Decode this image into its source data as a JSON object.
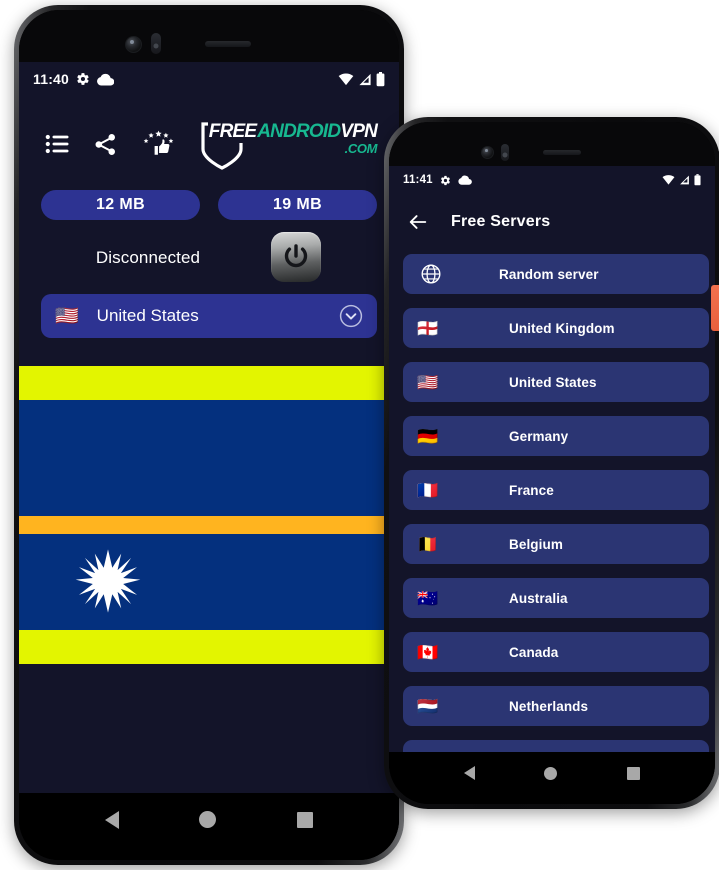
{
  "phone_home": {
    "statusbar": {
      "time": "11:40",
      "icons": [
        "gear-icon",
        "cloud-icon",
        "wifi-icon",
        "signal-icon",
        "battery-icon"
      ]
    },
    "header": {
      "icons": [
        {
          "name": "menu-list-icon",
          "label": "Menu"
        },
        {
          "name": "share-icon",
          "label": "Share"
        },
        {
          "name": "rate-thumbs-up-icon",
          "label": "Rate us"
        }
      ],
      "brand": {
        "part_free": "FREE",
        "part_android": "ANDROID",
        "part_vpn": "VPN",
        "part_com": ".COM",
        "color_white": "#ffffff",
        "color_teal": "#17b890"
      }
    },
    "stats": {
      "download": "12 MB",
      "upload": "19 MB"
    },
    "connection": {
      "status": "Disconnected",
      "power_button_label": "power-toggle"
    },
    "server_select": {
      "flag": "🇺🇸",
      "label": "United States",
      "chevron": "chevron-down-icon"
    },
    "ad_banner": {
      "label": "advertisement-banner",
      "colors": {
        "band": "#e3f500",
        "field": "#04307e",
        "stripe": "#ffb41f",
        "star": "#ffffff"
      }
    },
    "navbar": {
      "back": "back-triangle",
      "home": "home-circle",
      "recents": "recents-square"
    }
  },
  "phone_servers": {
    "statusbar": {
      "time": "11:41",
      "icons": [
        "gear-icon",
        "cloud-icon",
        "wifi-icon",
        "signal-icon",
        "battery-icon"
      ]
    },
    "header": {
      "back_label": "back-arrow",
      "title": "Free Servers"
    },
    "rows": [
      {
        "icon": "globe-icon",
        "flag": "",
        "label": "Random server"
      },
      {
        "icon": "flag",
        "flag": "🏴󠁧󠁢󠁥󠁮󠁧󠁿",
        "label": "United Kingdom"
      },
      {
        "icon": "flag",
        "flag": "🇺🇸",
        "label": "United States"
      },
      {
        "icon": "flag",
        "flag": "🇩🇪",
        "label": "Germany"
      },
      {
        "icon": "flag",
        "flag": "🇫🇷",
        "label": "France"
      },
      {
        "icon": "flag",
        "flag": "🇧🇪",
        "label": "Belgium"
      },
      {
        "icon": "flag",
        "flag": "🇦🇺",
        "label": "Australia"
      },
      {
        "icon": "flag",
        "flag": "🇨🇦",
        "label": "Canada"
      },
      {
        "icon": "flag",
        "flag": "🇳🇱",
        "label": "Netherlands"
      },
      {
        "icon": "flag",
        "flag": "",
        "label": ""
      }
    ],
    "navbar": {
      "back": "back-triangle",
      "home": "home-circle",
      "recents": "recents-square"
    }
  },
  "theme": {
    "screen_bg": "#131429",
    "pill_blue": "#2d3392",
    "row_blue": "#2b3573",
    "accent_teal": "#17b890",
    "sliver_orange": "#f2714e"
  }
}
